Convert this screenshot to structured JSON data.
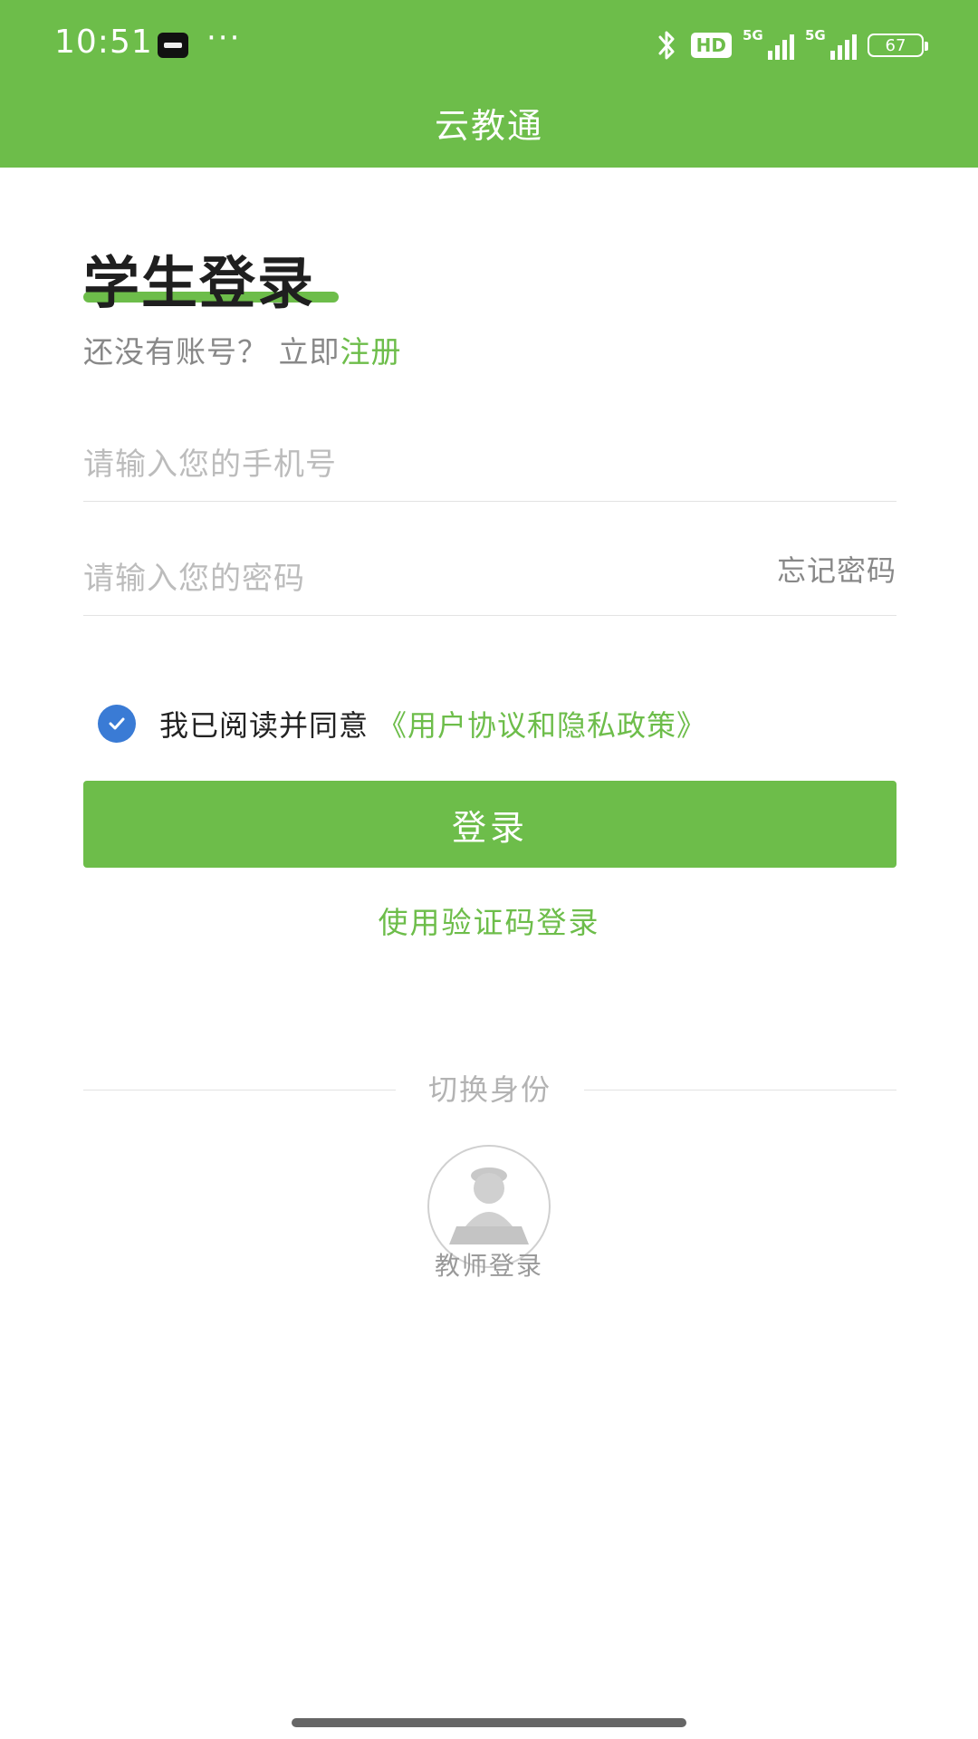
{
  "status_bar": {
    "time": "10:51",
    "more": "···",
    "hd_label": "HD",
    "network_1": "5G",
    "network_2": "5G",
    "battery": "67"
  },
  "header": {
    "title": "云教通"
  },
  "login": {
    "heading": "学生登录",
    "register_prompt": "还没有账号？ 立即",
    "register_link": "注册",
    "phone_placeholder": "请输入您的手机号",
    "phone_value": "",
    "password_placeholder": "请输入您的密码",
    "password_value": "",
    "forgot_password": "忘记密码",
    "agree_checked": true,
    "agree_text": "我已阅读并同意",
    "agreement_link": "《用户协议和隐私政策》",
    "login_button": "登录",
    "sms_login": "使用验证码登录"
  },
  "switch_identity": {
    "label": "切换身份",
    "teacher_login": "教师登录"
  },
  "colors": {
    "brand_green": "#6dbd4a",
    "check_blue": "#3a7bd5",
    "placeholder_gray": "#bcbcbc"
  },
  "icons": {
    "bluetooth": "bluetooth-icon",
    "check": "check-icon",
    "teacher_avatar": "teacher-avatar-icon"
  }
}
